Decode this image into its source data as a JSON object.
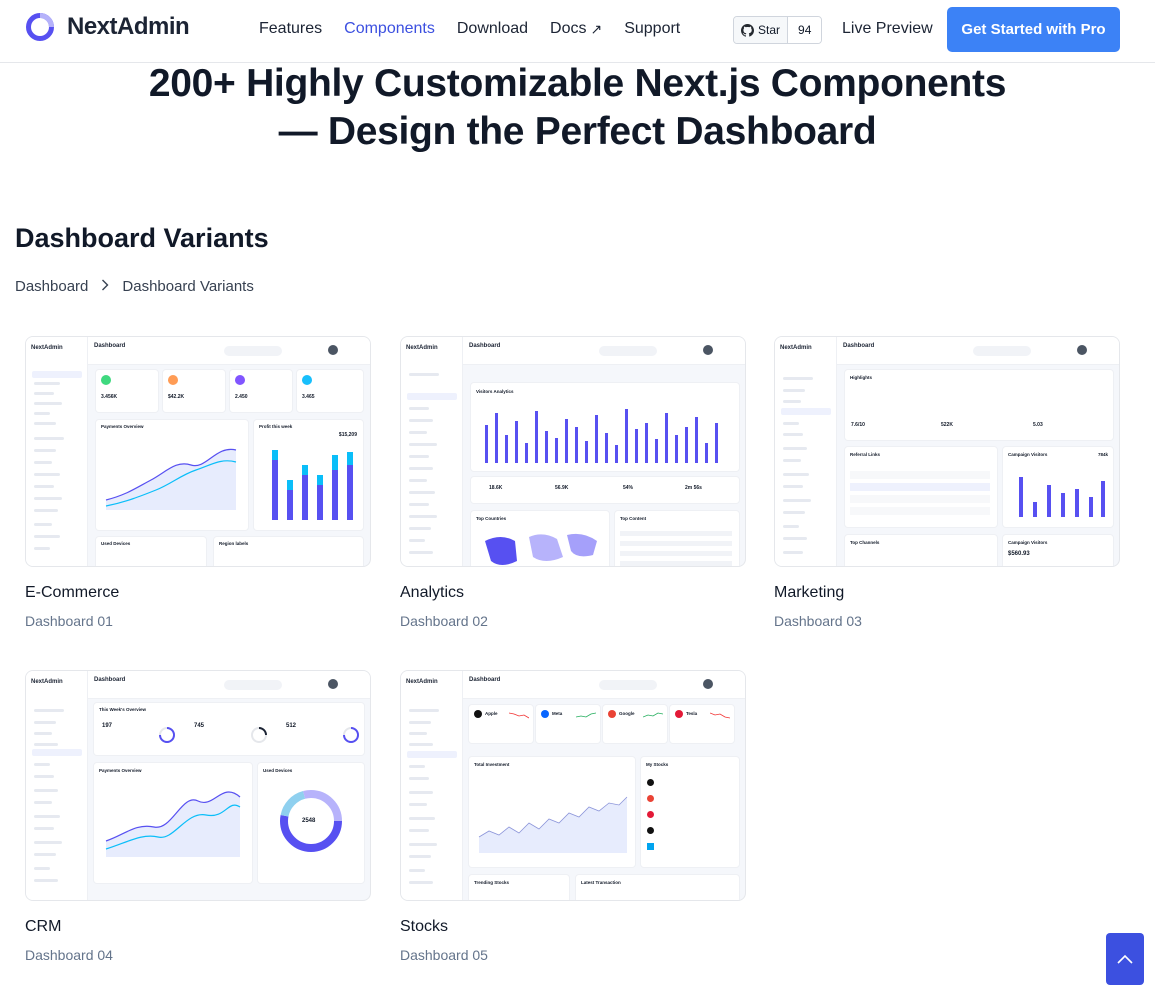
{
  "header": {
    "brand": "NextAdmin",
    "nav": [
      "Features",
      "Components",
      "Download",
      "Docs",
      "Support"
    ],
    "github": {
      "label": "Star",
      "count": "94"
    },
    "live_preview": "Live Preview",
    "cta": "Get Started with Pro",
    "accent": "#3c50e0",
    "cta_color": "#3c82f6"
  },
  "hero": {
    "line1": "200+ Highly Customizable Next.js Components",
    "line2": "— Design the Perfect Dashboard"
  },
  "section": {
    "title": "Dashboard Variants",
    "breadcrumb": [
      "Dashboard",
      "Dashboard Variants"
    ]
  },
  "cards": [
    {
      "title": "E-Commerce",
      "sub": "Dashboard 01"
    },
    {
      "title": "Analytics",
      "sub": "Dashboard 02"
    },
    {
      "title": "Marketing",
      "sub": "Dashboard 03"
    },
    {
      "title": "CRM",
      "sub": "Dashboard 04"
    },
    {
      "title": "Stocks",
      "sub": "Dashboard 05"
    }
  ],
  "thumbs": {
    "brand": "NextAdmin",
    "heading": "Dashboard",
    "ecommerce": {
      "p1": "Payments Overview",
      "p2": "Profit this week",
      "stat1": "3.456K",
      "stat2": "$42.2K",
      "stat3": "2.450",
      "stat4": "3.465",
      "p3": "Used Devices",
      "p4": "Region labels",
      "profit": "$15,209"
    },
    "analytics": {
      "p1": "Visitors Analytics",
      "s1": "18.6K",
      "s2": "56.9K",
      "s3": "54%",
      "s4": "2m 56s",
      "p2": "Top Countries",
      "p3": "Top Content"
    },
    "marketing": {
      "p1": "Highlights",
      "m1": "7.6/10",
      "m2": "522K",
      "m3": "5.03",
      "p2": "Referral Links",
      "p3": "Campaign Visitors",
      "cv": "784k",
      "p4": "Top Channels",
      "p5": "Campaign Visitors",
      "cv2": "$560.93"
    },
    "crm": {
      "p1": "This Week's Overview",
      "c1": "197",
      "c2": "745",
      "c3": "512",
      "p2": "Payments Overview",
      "p3": "Used Devices",
      "donut": "2548"
    },
    "stocks": {
      "tickers": [
        "Apple",
        "Meta",
        "Google",
        "Tesla"
      ],
      "p1": "Total Investment",
      "p2": "My Stocks",
      "p3": "Trending Stocks",
      "p4": "Latest Transaction"
    }
  }
}
